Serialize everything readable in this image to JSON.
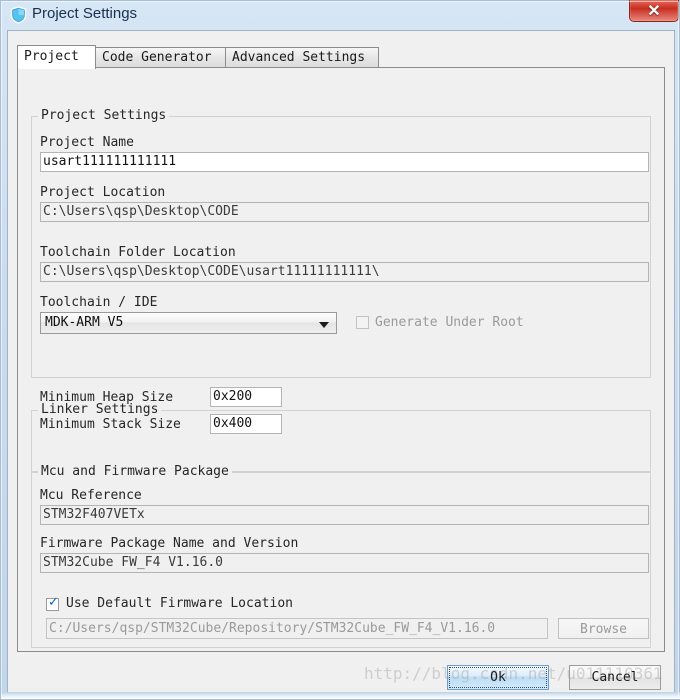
{
  "window": {
    "title": "Project Settings",
    "icon": "shield-icon",
    "close_label": "✕"
  },
  "tabs": [
    {
      "label": "Project",
      "active": true
    },
    {
      "label": "Code Generator",
      "active": false
    },
    {
      "label": "Advanced Settings",
      "active": false
    }
  ],
  "project_settings": {
    "group_title": "Project Settings",
    "project_name_label": "Project Name",
    "project_name_value": "usart111111111111",
    "project_location_label": "Project Location",
    "project_location_value": "C:\\Users\\qsp\\Desktop\\CODE",
    "toolchain_folder_label": "Toolchain Folder Location",
    "toolchain_folder_value": "C:\\Users\\qsp\\Desktop\\CODE\\usart11111111111\\",
    "toolchain_ide_label": "Toolchain / IDE",
    "toolchain_ide_value": "MDK-ARM V5",
    "generate_under_root_label": "Generate Under Root",
    "generate_under_root_checked": false
  },
  "linker_settings": {
    "group_title": "Linker Settings",
    "heap_label": "Minimum Heap Size",
    "heap_value": "0x200",
    "stack_label": "Minimum Stack Size",
    "stack_value": "0x400"
  },
  "mcu_firmware": {
    "group_title": "Mcu and Firmware Package",
    "mcu_reference_label": "Mcu Reference",
    "mcu_reference_value": "STM32F407VETx",
    "firmware_package_label": "Firmware Package Name and Version",
    "firmware_package_value": "STM32Cube FW_F4 V1.16.0",
    "use_default_label": "Use Default Firmware Location",
    "use_default_checked": true,
    "firmware_path_value": "C:/Users/qsp/STM32Cube/Repository/STM32Cube_FW_F4_V1.16.0",
    "browse_label": "Browse"
  },
  "footer": {
    "ok_label": "Ok",
    "cancel_label": "Cancel"
  },
  "watermark": {
    "text": "http://blog.csdn.net/u011110361"
  },
  "colors": {
    "title_text": "#15314f",
    "close_button": "#c62f20",
    "default_button": "#bcdcf4",
    "checkbox_tick": "#1565c0",
    "window_chrome": "#c2d6ea"
  }
}
